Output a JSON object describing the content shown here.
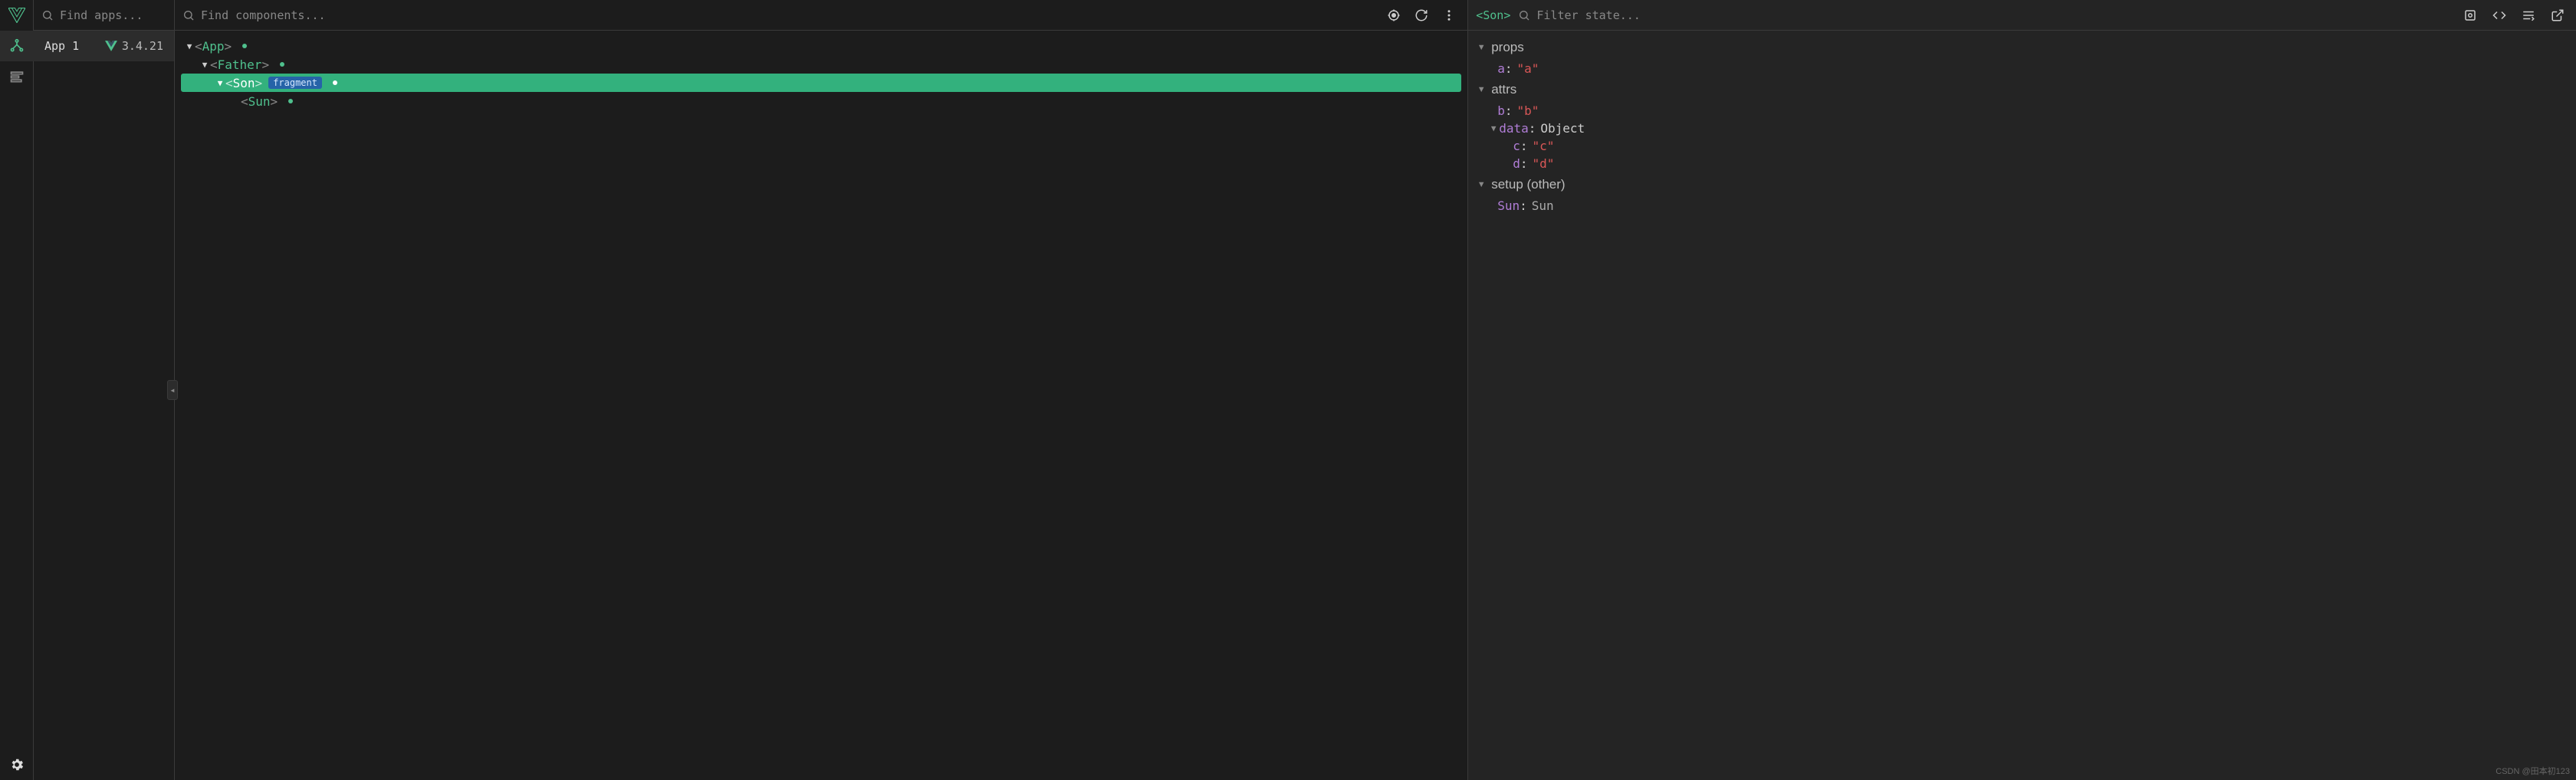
{
  "rail": {
    "active_tab": "components"
  },
  "apps_search": {
    "placeholder": "Find apps..."
  },
  "app": {
    "name": "App 1",
    "version": "3.4.21"
  },
  "components_search": {
    "placeholder": "Find components..."
  },
  "tree": {
    "n0": {
      "name": "App"
    },
    "n1": {
      "name": "Father"
    },
    "n2": {
      "name": "Son",
      "badge": "fragment"
    },
    "n3": {
      "name": "Sun"
    }
  },
  "state_header": {
    "selected_name": "<Son>",
    "filter_placeholder": "Filter state..."
  },
  "state": {
    "sections": {
      "props": {
        "title": "props"
      },
      "attrs": {
        "title": "attrs"
      },
      "setup": {
        "title": "setup (other)"
      }
    },
    "props": {
      "a": {
        "key": "a",
        "value": "\"a\""
      }
    },
    "attrs": {
      "b": {
        "key": "b",
        "value": "\"b\""
      },
      "data": {
        "key": "data",
        "type": "Object"
      },
      "c": {
        "key": "c",
        "value": "\"c\""
      },
      "d": {
        "key": "d",
        "value": "\"d\""
      }
    },
    "setup": {
      "Sun": {
        "key": "Sun",
        "value": "Sun"
      }
    }
  },
  "watermark": "CSDN @田本初123"
}
